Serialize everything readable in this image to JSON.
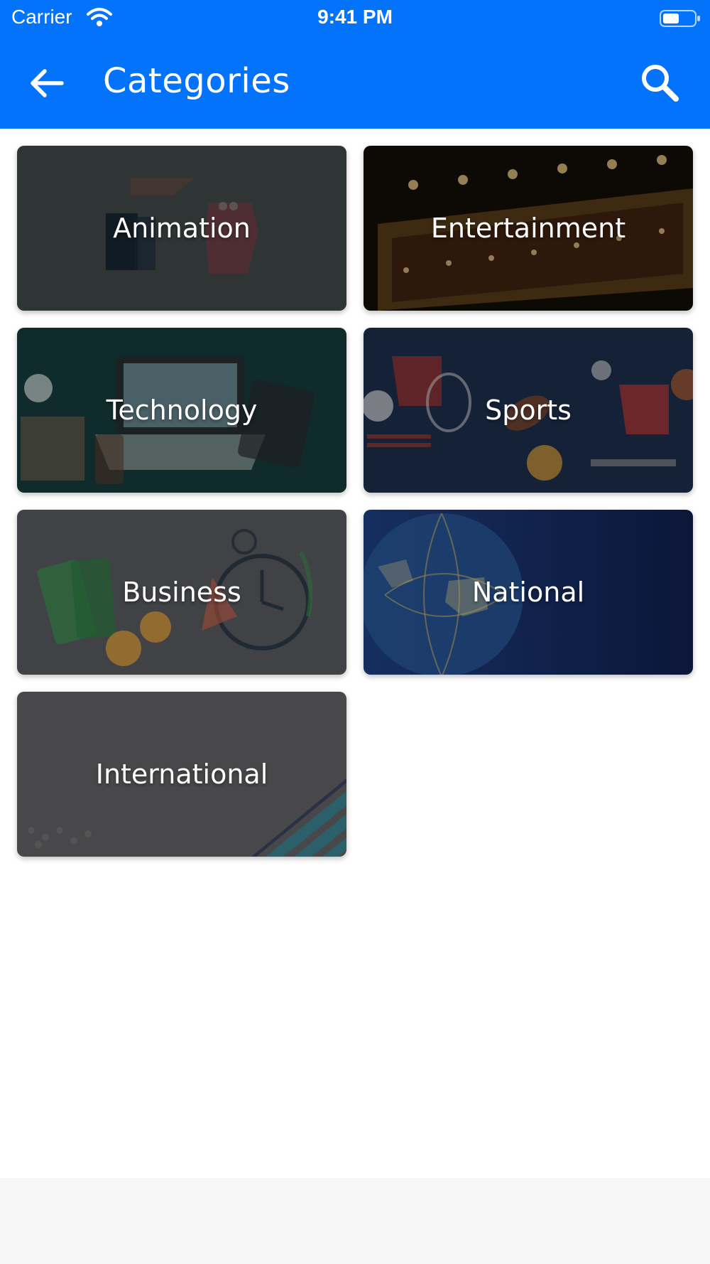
{
  "status_bar": {
    "carrier": "Carrier",
    "time": "9:41 PM"
  },
  "app_bar": {
    "title": "Categories",
    "back_icon": "arrow-left-icon",
    "search_icon": "search-icon",
    "background": "#0473fb"
  },
  "categories": [
    {
      "label": "Animation",
      "color": "#3e4746"
    },
    {
      "label": "Entertainment",
      "color": "#1a140c"
    },
    {
      "label": "Technology",
      "color": "#163a3a"
    },
    {
      "label": "Sports",
      "color": "#1b2c4a"
    },
    {
      "label": "Business",
      "color": "#46474c"
    },
    {
      "label": "National",
      "color": "#14285a"
    },
    {
      "label": "International",
      "color": "#4b4b4c"
    }
  ]
}
